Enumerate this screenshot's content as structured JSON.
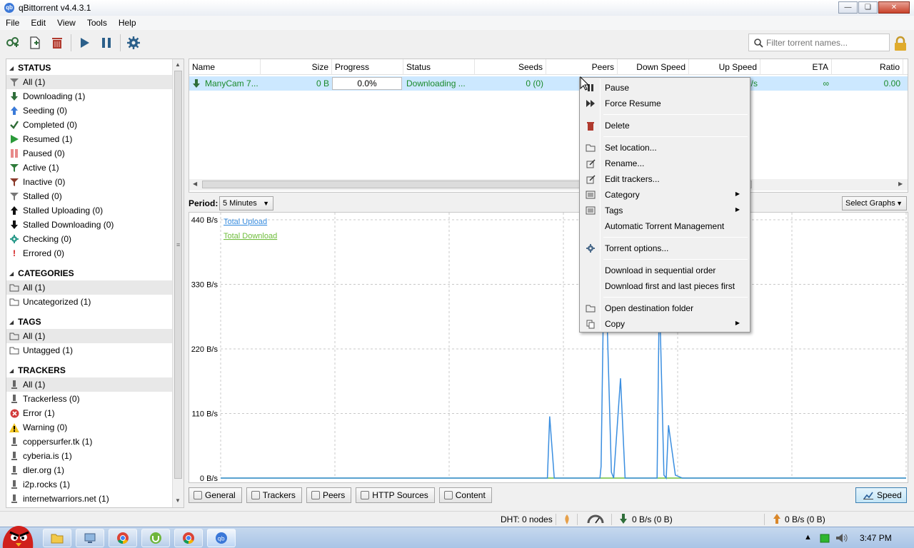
{
  "window": {
    "title": "qBittorrent v4.4.3.1",
    "app_icon": "qb"
  },
  "menubar": [
    "File",
    "Edit",
    "View",
    "Tools",
    "Help"
  ],
  "toolbar": {
    "icons": [
      "add-link-icon",
      "add-torrent-file-icon",
      "delete-icon",
      "resume-icon",
      "pause-icon",
      "options-gear-icon"
    ],
    "filter_placeholder": "Filter torrent names..."
  },
  "sidebar": {
    "status": {
      "title": "STATUS",
      "items": [
        {
          "label": "All (1)",
          "icon": "filter-icon"
        },
        {
          "label": "Downloading (1)",
          "icon": "download-arrow-icon"
        },
        {
          "label": "Seeding (0)",
          "icon": "upload-arrow-icon"
        },
        {
          "label": "Completed (0)",
          "icon": "checkmark-icon"
        },
        {
          "label": "Resumed (1)",
          "icon": "play-icon"
        },
        {
          "label": "Paused (0)",
          "icon": "pause-icon"
        },
        {
          "label": "Active (1)",
          "icon": "filter-icon"
        },
        {
          "label": "Inactive (0)",
          "icon": "filter-icon"
        },
        {
          "label": "Stalled (0)",
          "icon": "filter-icon"
        },
        {
          "label": "Stalled Uploading (0)",
          "icon": "upload-arrow-icon"
        },
        {
          "label": "Stalled Downloading (0)",
          "icon": "download-arrow-icon"
        },
        {
          "label": "Checking (0)",
          "icon": "gear-icon"
        },
        {
          "label": "Errored (0)",
          "icon": "exclamation-icon"
        }
      ]
    },
    "categories": {
      "title": "CATEGORIES",
      "items": [
        {
          "label": "All (1)"
        },
        {
          "label": "Uncategorized (1)"
        }
      ]
    },
    "tags": {
      "title": "TAGS",
      "items": [
        {
          "label": "All (1)"
        },
        {
          "label": "Untagged (1)"
        }
      ]
    },
    "trackers": {
      "title": "TRACKERS",
      "items": [
        {
          "label": "All (1)"
        },
        {
          "label": "Trackerless (0)"
        },
        {
          "label": "Error (1)"
        },
        {
          "label": "Warning (0)"
        },
        {
          "label": "coppersurfer.tk (1)"
        },
        {
          "label": "cyberia.is (1)"
        },
        {
          "label": "dler.org (1)"
        },
        {
          "label": "i2p.rocks (1)"
        },
        {
          "label": "internetwarriors.net (1)"
        }
      ]
    }
  },
  "torrent_list": {
    "columns": [
      "Name",
      "Size",
      "Progress",
      "Status",
      "Seeds",
      "Peers",
      "Down Speed",
      "Up Speed",
      "ETA",
      "Ratio"
    ],
    "rows": [
      {
        "name": "ManyCam 7...",
        "size": "0 B",
        "progress": "0.0%",
        "status": "Downloading ...",
        "seeds": "0 (0)",
        "up_speed": "/s",
        "eta": "∞",
        "ratio": "0.00"
      }
    ]
  },
  "graph": {
    "period_label": "Period:",
    "period_value": "5 Minutes",
    "select_graphs": "Select Graphs",
    "legend": {
      "upload": "Total Upload",
      "download": "Total Download"
    },
    "y_ticks": [
      "440 B/s",
      "330 B/s",
      "220 B/s",
      "110 B/s",
      "0 B/s"
    ],
    "colors": {
      "upload": "#3a8ee0",
      "download": "#6fbd3c"
    }
  },
  "chart_data": {
    "type": "line",
    "title": "",
    "xlabel": "",
    "ylabel": "",
    "ylim": [
      0,
      440
    ],
    "grid": true,
    "legend_placement": "top-left",
    "series": [
      {
        "name": "Total Upload",
        "x": [
          0,
          143,
          144,
          146,
          155,
          166,
          166.5,
          168,
          171,
          172,
          175,
          177,
          178,
          185,
          191,
          192,
          194,
          195,
          196,
          199,
          202,
          300
        ],
        "values": [
          0,
          0,
          105,
          0,
          0,
          0,
          20,
          425,
          10,
          0,
          170,
          0,
          0,
          0,
          0,
          320,
          5,
          0,
          90,
          5,
          0,
          0
        ]
      },
      {
        "name": "Total Download",
        "x": [
          0,
          300
        ],
        "values": [
          0,
          0
        ]
      }
    ]
  },
  "bottom_tabs": [
    "General",
    "Trackers",
    "Peers",
    "HTTP Sources",
    "Content"
  ],
  "speed_tab": "Speed",
  "statusbar": {
    "dht": "DHT: 0 nodes",
    "down": "0 B/s (0 B)",
    "up": "0 B/s (0 B)"
  },
  "context_menu": [
    {
      "label": "Pause",
      "icon": "pause-icon"
    },
    {
      "label": "Force Resume",
      "icon": "fast-forward-icon"
    },
    {
      "sep": true
    },
    {
      "label": "Delete",
      "icon": "trash-icon"
    },
    {
      "sep": true
    },
    {
      "label": "Set location...",
      "icon": "folder-icon"
    },
    {
      "label": "Rename...",
      "icon": "edit-icon"
    },
    {
      "label": "Edit trackers...",
      "icon": "edit-icon"
    },
    {
      "label": "Category",
      "icon": "list-icon",
      "submenu": true
    },
    {
      "label": "Tags",
      "icon": "list-icon",
      "submenu": true
    },
    {
      "label": "Automatic Torrent Management"
    },
    {
      "sep": true
    },
    {
      "label": "Torrent options...",
      "icon": "gear-icon"
    },
    {
      "sep": true
    },
    {
      "label": "Download in sequential order"
    },
    {
      "label": "Download first and last pieces first"
    },
    {
      "sep": true
    },
    {
      "label": "Open destination folder",
      "icon": "folder-icon"
    },
    {
      "label": "Copy",
      "icon": "copy-icon",
      "submenu": true
    }
  ],
  "taskbar": {
    "clock": "3:47 PM"
  }
}
